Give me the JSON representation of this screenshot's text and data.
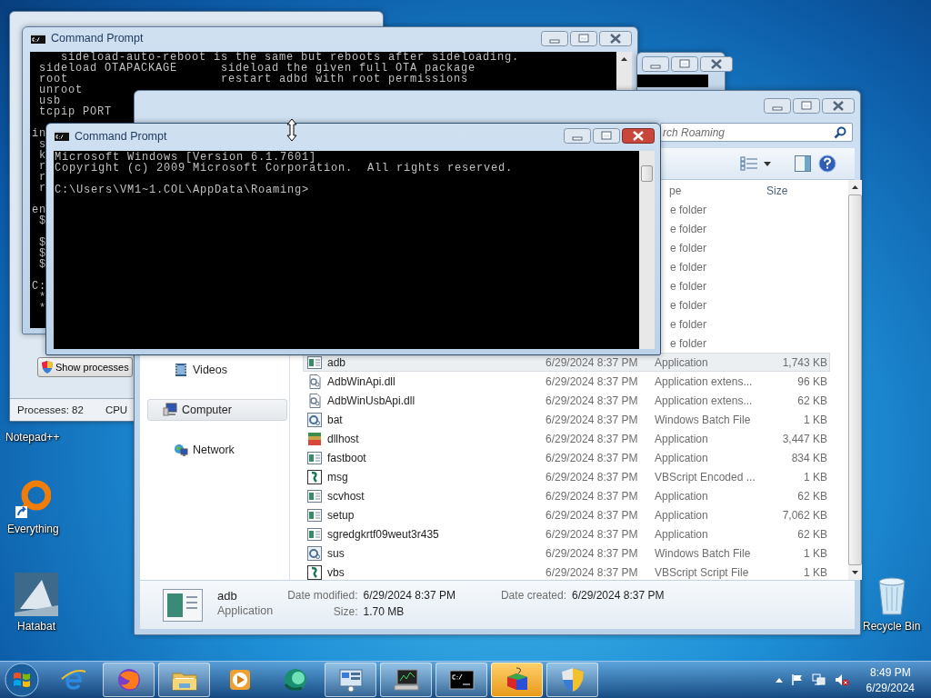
{
  "desktop_icons": [
    {
      "kind": "label",
      "label": "Notepad++"
    },
    {
      "kind": "ring",
      "label": "Everything"
    },
    {
      "kind": "picture",
      "label": "Hatabat"
    },
    {
      "kind": "bin",
      "label": "Recycle Bin"
    }
  ],
  "task_manager": {
    "button": "Show processes",
    "status": [
      "Processes: 82",
      "CPU"
    ]
  },
  "console_back": {
    "title": "Command Prompt",
    "active": false,
    "blocks": [
      [
        "    sideload-auto-reboot is the same but reboots after sideloading.",
        " sideload OTAPACKAGE      sideload the given full OTA package",
        " root                     restart adbd with root permissions",
        " unroot",
        " usb",
        " tcpip PORT"
      ],
      [
        "in",
        " s",
        " k",
        " r",
        " r",
        " r"
      ],
      [
        "en",
        " $"
      ],
      [
        " $",
        " $",
        " $"
      ],
      [
        "C:",
        " *",
        " *"
      ]
    ]
  },
  "explorer": {
    "active": false,
    "search": {
      "placeholder": "rch Roaming"
    },
    "columns": [
      "pe",
      "Size"
    ],
    "nav": [
      {
        "kind": "videos",
        "label": "Videos",
        "selected": false
      },
      {
        "kind": "computer",
        "label": "Computer",
        "selected": true
      },
      {
        "kind": "network",
        "label": "Network",
        "selected": false
      }
    ],
    "rows": [
      {
        "kind": "cut",
        "type": "e folder",
        "selected": false
      },
      {
        "kind": "cut",
        "type": "e folder",
        "selected": false
      },
      {
        "kind": "cut",
        "type": "e folder",
        "selected": false
      },
      {
        "kind": "cut",
        "type": "e folder",
        "selected": false
      },
      {
        "kind": "cut",
        "type": "e folder",
        "selected": false
      },
      {
        "kind": "cut",
        "type": "e folder",
        "selected": false
      },
      {
        "kind": "cut",
        "type": "e folder",
        "selected": false
      },
      {
        "kind": "cut",
        "type": "e folder",
        "selected": false
      },
      {
        "kind": "app",
        "name": "adb",
        "date": "6/29/2024 8:37 PM",
        "type": "Application",
        "size": "1,743 KB",
        "selected": true
      },
      {
        "kind": "extension",
        "name": "AdbWinApi.dll",
        "date": "6/29/2024 8:37 PM",
        "type": "Application extens...",
        "size": "96 KB",
        "selected": false
      },
      {
        "kind": "extension",
        "name": "AdbWinUsbApi.dll",
        "date": "6/29/2024 8:37 PM",
        "type": "Application extens...",
        "size": "62 KB",
        "selected": false
      },
      {
        "kind": "batch",
        "name": "bat",
        "date": "6/29/2024 8:37 PM",
        "type": "Windows Batch File",
        "size": "1 KB",
        "selected": false
      },
      {
        "kind": "stack",
        "name": "dllhost",
        "date": "6/29/2024 8:37 PM",
        "type": "Application",
        "size": "3,447 KB",
        "selected": false
      },
      {
        "kind": "app",
        "name": "fastboot",
        "date": "6/29/2024 8:37 PM",
        "type": "Application",
        "size": "834 KB",
        "selected": false
      },
      {
        "kind": "script",
        "name": "msg",
        "date": "6/29/2024 8:37 PM",
        "type": "VBScript Encoded ...",
        "size": "1 KB",
        "selected": false
      },
      {
        "kind": "app",
        "name": "scvhost",
        "date": "6/29/2024 8:37 PM",
        "type": "Application",
        "size": "62 KB",
        "selected": false
      },
      {
        "kind": "app",
        "name": "setup",
        "date": "6/29/2024 8:37 PM",
        "type": "Application",
        "size": "7,062 KB",
        "selected": false
      },
      {
        "kind": "app",
        "name": "sgredgkrtf09weut3r435",
        "date": "6/29/2024 8:37 PM",
        "type": "Application",
        "size": "62 KB",
        "selected": false
      },
      {
        "kind": "batch",
        "name": "sus",
        "date": "6/29/2024 8:37 PM",
        "type": "Windows Batch File",
        "size": "1 KB",
        "selected": false
      },
      {
        "kind": "script",
        "name": "vbs",
        "date": "6/29/2024 8:37 PM",
        "type": "VBScript Script File",
        "size": "1 KB",
        "selected": false
      }
    ],
    "details": {
      "name": "adb",
      "type": "Application",
      "groups": [
        [
          {
            "label": "Date modified:",
            "value": "6/29/2024 8:37 PM"
          },
          {
            "label": "Size:",
            "value": "1.70 MB"
          }
        ],
        [
          {
            "label": "Date created:",
            "value": "6/29/2024 8:37 PM"
          }
        ]
      ]
    }
  },
  "console_front": {
    "title": "Command Prompt",
    "active": true,
    "blocks": [
      [
        "Microsoft Windows [Version 6.1.7601]",
        "Copyright (c) 2009 Microsoft Corporation.  All rights reserved."
      ],
      [
        "C:\\Users\\VM1~1.COL\\AppData\\Roaming>"
      ]
    ]
  },
  "taskbar": {
    "items": [
      {
        "kind": "elogo",
        "running": false,
        "attention": false
      },
      {
        "kind": "globe",
        "running": true,
        "attention": false
      },
      {
        "kind": "folder",
        "running": true,
        "attention": false
      },
      {
        "kind": "play",
        "running": false,
        "attention": false
      },
      {
        "kind": "orb",
        "running": false,
        "attention": false
      },
      {
        "kind": "panel",
        "running": true,
        "attention": false
      },
      {
        "kind": "monitor",
        "running": true,
        "attention": false
      },
      {
        "kind": "console",
        "running": true,
        "attention": false
      },
      {
        "kind": "cube",
        "running": true,
        "attention": true
      },
      {
        "kind": "shield",
        "running": true,
        "attention": false
      }
    ],
    "clock": {
      "time": "8:49 PM",
      "date": "6/29/2024"
    }
  }
}
